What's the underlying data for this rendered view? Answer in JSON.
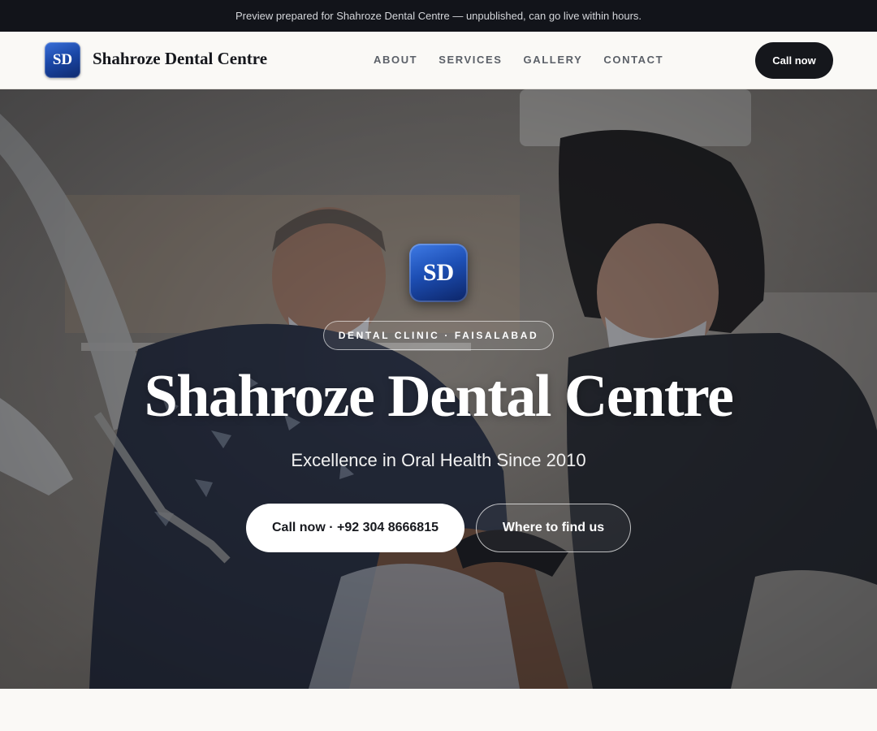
{
  "topbar": {
    "text": "Preview prepared for Shahroze Dental Centre — unpublished, can go live within hours."
  },
  "header": {
    "logo_initials": "SD",
    "brand_name": "Shahroze Dental Centre",
    "nav": [
      {
        "label": "ABOUT"
      },
      {
        "label": "SERVICES"
      },
      {
        "label": "GALLERY"
      },
      {
        "label": "CONTACT"
      }
    ],
    "cta_label": "Call now"
  },
  "hero": {
    "logo_initials": "SD",
    "eyebrow": "DENTAL CLINIC · FAISALABAD",
    "title": "Shahroze Dental Centre",
    "subtitle": "Excellence in Oral Health Since 2010",
    "primary_button": "Call now · +92 304 8666815",
    "secondary_button": "Where to find us",
    "photo_icon": "dental-procedure-photo"
  },
  "colors": {
    "topbar_bg": "#12141a",
    "header_bg": "#faf9f6",
    "brand_blue": "#1d4fb5",
    "dark_button": "#15171c"
  }
}
